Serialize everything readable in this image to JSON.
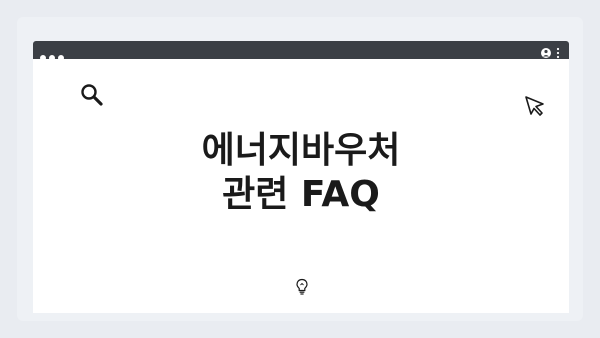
{
  "window": {
    "title_line1": "에너지바우처",
    "title_line2": "관련 FAQ"
  },
  "icons": {
    "search": "search-icon",
    "cursor": "cursor-icon",
    "user": "user-icon",
    "menu": "kebab-menu-icon",
    "bulb": "lightbulb-icon"
  },
  "colors": {
    "browser_bar": "#3b3f45",
    "background": "#e9ecf1",
    "frame": "#eef1f5",
    "content": "#ffffff",
    "text": "#1a1a1a"
  }
}
